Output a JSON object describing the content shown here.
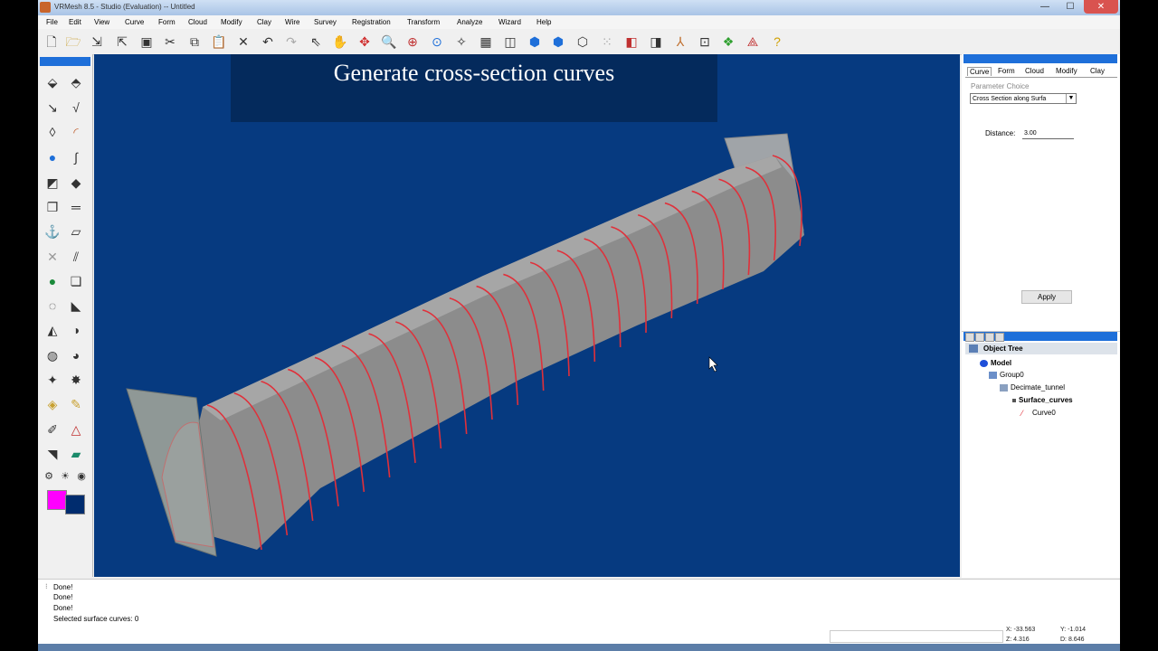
{
  "window": {
    "title": "VRMesh 8.5 - Studio (Evaluation) -- Untitled",
    "minimize": "—",
    "maximize": "☐",
    "close": "✕"
  },
  "menu": [
    "File",
    "Edit",
    "View",
    "Curve",
    "Form",
    "Cloud",
    "Modify",
    "Clay",
    "Wire",
    "Survey",
    "Registration",
    "Transform",
    "Analyze",
    "Wizard",
    "Help"
  ],
  "toolbar_icons": [
    "new-file",
    "open-folder",
    "import",
    "export",
    "save",
    "cut",
    "copy",
    "paste",
    "delete",
    "undo",
    "redo",
    "select-arrow",
    "pan-hand",
    "move",
    "zoom",
    "zoom-window",
    "zoom-fit",
    "rotate",
    "grid",
    "section",
    "view-blue-1",
    "view-blue-2",
    "cube-outline",
    "cube-dots",
    "box-red",
    "box-gray",
    "axis",
    "lock-box",
    "layers",
    "curve-tool",
    "help"
  ],
  "banner": {
    "text": "Generate cross-section curves"
  },
  "right_panel": {
    "tabs": [
      "Curve",
      "Form",
      "Cloud",
      "Modify",
      "Clay"
    ],
    "active_tab": "Curve",
    "parameter_label": "Parameter Choice",
    "parameter_value": "Cross Section along Surfa",
    "distance_label": "Distance:",
    "distance_value": "3.00",
    "apply_label": "Apply"
  },
  "object_tree": {
    "title": "Object Tree",
    "items": [
      {
        "label": "Model",
        "bold": true
      },
      {
        "label": "Group0",
        "bold": false
      },
      {
        "label": "Decimate_tunnel",
        "bold": false
      },
      {
        "label": "Surface_curves",
        "bold": true
      },
      {
        "label": "Curve0",
        "bold": false
      }
    ]
  },
  "log": {
    "lines": [
      "Done!",
      "Done!",
      "Done!",
      "Selected surface curves: 0"
    ]
  },
  "coords": {
    "x": "X: -33.563",
    "y": "Y: -1.014",
    "z": "Z: 4.316",
    "d": "D: 8.646"
  },
  "colors": {
    "viewport_bg": "#063a80",
    "banner_bg": "#042a5c",
    "curve_red": "#e0303a",
    "tunnel_gray": "#9a9a9a",
    "accent": "#1e6fd9",
    "swatch_magenta": "#ff00ff",
    "swatch_blue": "#002c6e"
  }
}
